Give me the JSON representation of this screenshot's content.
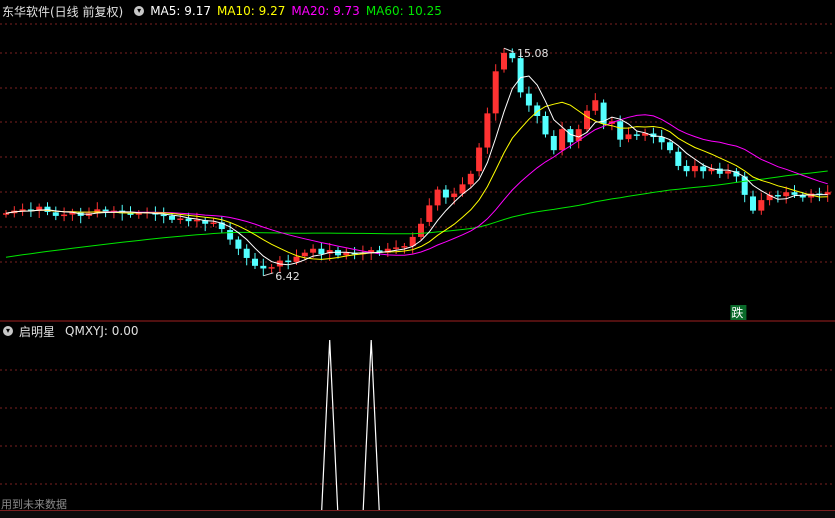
{
  "main_legend": {
    "title": "东华软件(日线 前复权)",
    "ma5": "MA5: 9.17",
    "ma10": "MA10: 9.27",
    "ma20": "MA20: 9.73",
    "ma60": "MA60: 10.25"
  },
  "annotations": {
    "high_label": "15.08",
    "low_label": "6.42",
    "signal_badge": "跌"
  },
  "indicator": {
    "title": "启明星",
    "value_label": "QMXYJ: 0.00"
  },
  "footer_note": "用到未来数据",
  "colors": {
    "up": "#ff3232",
    "down": "#54ffff",
    "ma5": "#ffffff",
    "ma10": "#ffff00",
    "ma20": "#ff00ff",
    "ma60": "#00e600",
    "grid": "#7a1f1f"
  },
  "chart_data": {
    "type": "candlestick",
    "price_range": [
      5.5,
      16.0
    ],
    "high": 15.08,
    "low": 6.42,
    "closes": [
      8.8,
      8.9,
      8.95,
      8.9,
      9.05,
      8.85,
      8.7,
      8.75,
      8.85,
      8.7,
      8.8,
      8.95,
      8.85,
      8.9,
      8.8,
      8.75,
      8.8,
      8.85,
      8.75,
      8.7,
      8.55,
      8.6,
      8.5,
      8.55,
      8.4,
      8.45,
      8.2,
      7.8,
      7.45,
      7.1,
      6.8,
      6.7,
      6.75,
      7.0,
      6.95,
      7.15,
      7.3,
      7.45,
      7.25,
      7.4,
      7.2,
      7.3,
      7.25,
      7.3,
      7.4,
      7.3,
      7.45,
      7.5,
      7.55,
      7.9,
      8.4,
      9.1,
      9.7,
      9.4,
      9.55,
      9.9,
      10.3,
      11.3,
      12.6,
      14.2,
      14.9,
      14.7,
      13.4,
      12.9,
      12.5,
      11.8,
      11.2,
      12.0,
      11.5,
      12.0,
      12.7,
      13.1,
      12.2,
      12.3,
      11.6,
      11.8,
      11.75,
      11.85,
      11.7,
      11.5,
      11.2,
      10.6,
      10.4,
      10.6,
      10.4,
      10.5,
      10.3,
      10.4,
      10.2,
      9.5,
      8.9,
      9.3,
      9.5,
      9.45,
      9.6,
      9.5,
      9.4,
      9.55,
      9.5,
      9.6
    ],
    "indicator_spikes": [
      {
        "bar": 39
      },
      {
        "bar": 44
      }
    ]
  }
}
